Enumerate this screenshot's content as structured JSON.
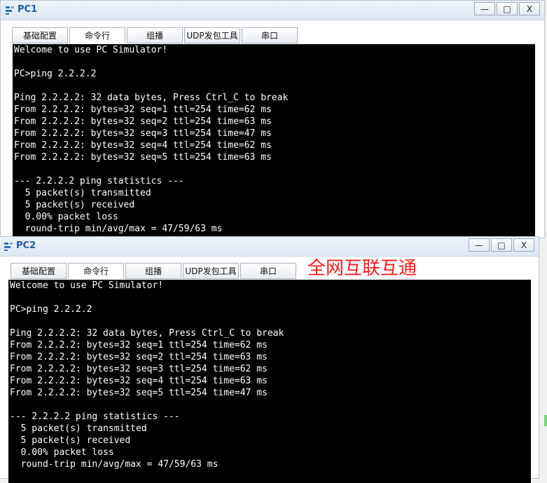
{
  "windows": [
    {
      "title": "PC1",
      "tabs": [
        "基础配置",
        "命令行",
        "组播",
        "UDP发包工具",
        "串口"
      ],
      "active_tab": 1,
      "console_lines": [
        "Welcome to use PC Simulator!",
        "",
        "PC>ping 2.2.2.2",
        "",
        "Ping 2.2.2.2: 32 data bytes, Press Ctrl_C to break",
        "From 2.2.2.2: bytes=32 seq=1 ttl=254 time=62 ms",
        "From 2.2.2.2: bytes=32 seq=2 ttl=254 time=63 ms",
        "From 2.2.2.2: bytes=32 seq=3 ttl=254 time=47 ms",
        "From 2.2.2.2: bytes=32 seq=4 ttl=254 time=62 ms",
        "From 2.2.2.2: bytes=32 seq=5 ttl=254 time=63 ms",
        "",
        "--- 2.2.2.2 ping statistics ---",
        "  5 packet(s) transmitted",
        "  5 packet(s) received",
        "  0.00% packet loss",
        "  round-trip min/avg/max = 47/59/63 ms"
      ]
    },
    {
      "title": "PC2",
      "tabs": [
        "基础配置",
        "命令行",
        "组播",
        "UDP发包工具",
        "串口"
      ],
      "active_tab": 1,
      "console_lines": [
        "Welcome to use PC Simulator!",
        "",
        "PC>ping 2.2.2.2",
        "",
        "Ping 2.2.2.2: 32 data bytes, Press Ctrl_C to break",
        "From 2.2.2.2: bytes=32 seq=1 ttl=254 time=62 ms",
        "From 2.2.2.2: bytes=32 seq=2 ttl=254 time=63 ms",
        "From 2.2.2.2: bytes=32 seq=3 ttl=254 time=62 ms",
        "From 2.2.2.2: bytes=32 seq=4 ttl=254 time=63 ms",
        "From 2.2.2.2: bytes=32 seq=5 ttl=254 time=47 ms",
        "",
        "--- 2.2.2.2 ping statistics ---",
        "  5 packet(s) transmitted",
        "  5 packet(s) received",
        "  0.00% packet loss",
        "  round-trip min/avg/max = 47/59/63 ms"
      ],
      "annotation": "全网互联互通"
    }
  ],
  "window_buttons": {
    "minimize": "—",
    "maximize": "□",
    "close": "X"
  },
  "icons": {
    "app": "network-device-icon"
  },
  "colors": {
    "console_bg": "#000000",
    "console_text": "#ffffff",
    "title_text": "#1e5aa8",
    "annotation": "#ff1a1a"
  }
}
